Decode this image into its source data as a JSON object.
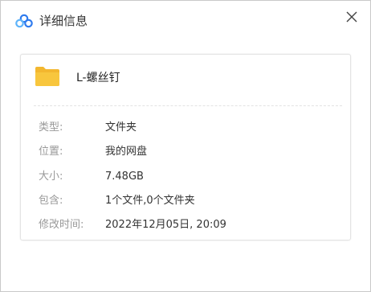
{
  "dialog": {
    "title": "详细信息",
    "close_symbol": "×"
  },
  "file": {
    "name": "L-螺丝钉",
    "icon": "folder-icon"
  },
  "details": [
    {
      "label": "类型:",
      "value": "文件夹"
    },
    {
      "label": "位置:",
      "value": "我的网盘"
    },
    {
      "label": "大小:",
      "value": "7.48GB"
    },
    {
      "label": "包含:",
      "value": "1个文件,0个文件夹"
    },
    {
      "label": "修改时间:",
      "value": "2022年12月05日, 20:09"
    }
  ],
  "colors": {
    "folder": "#F8C63D",
    "brand_blue": "#2F7BEE",
    "brand_light": "#5FB4FA"
  }
}
